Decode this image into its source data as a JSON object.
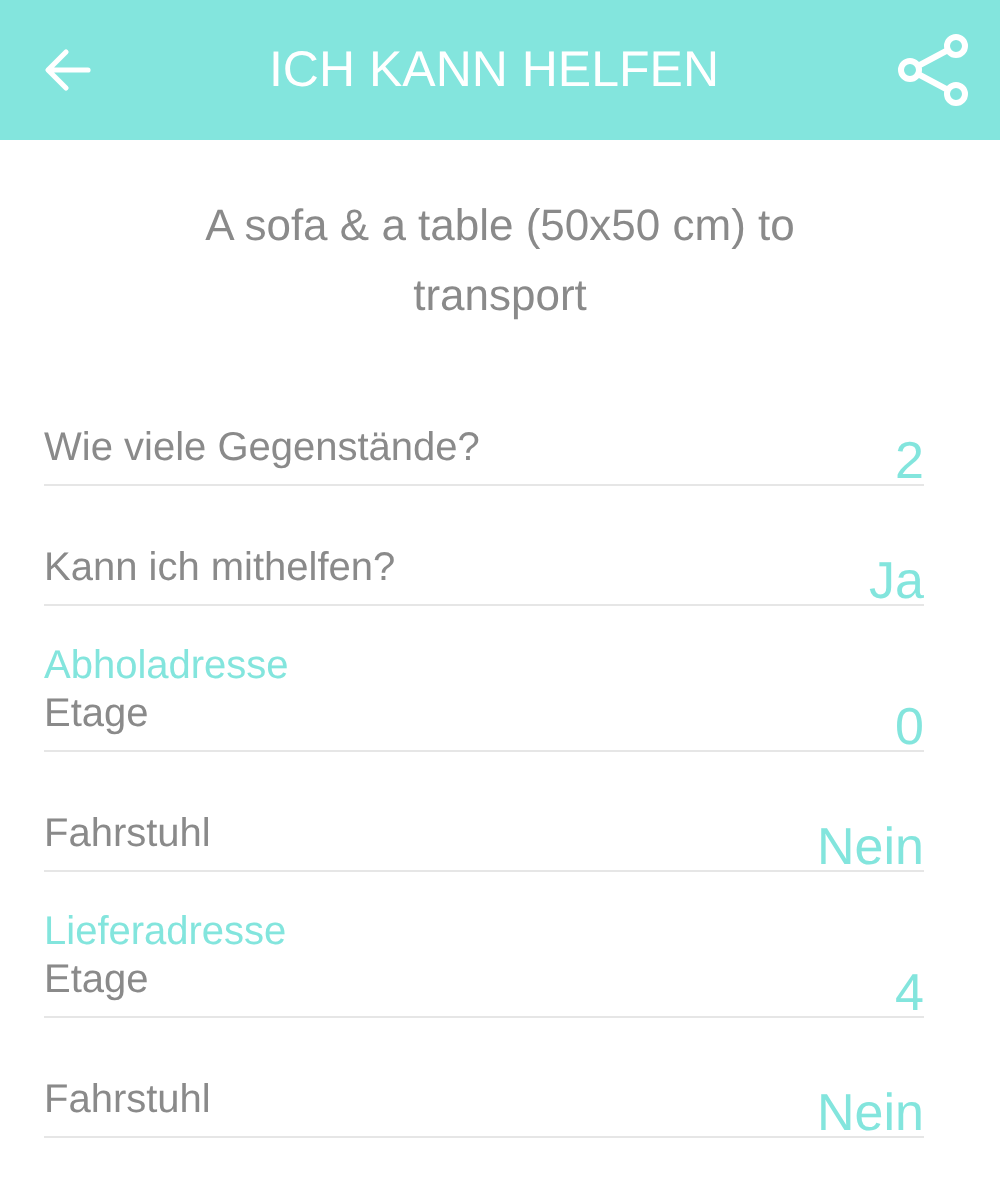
{
  "header": {
    "title": "ICH KANN HELFEN"
  },
  "subtitle": "A sofa & a table (50x50 cm) to transport",
  "items": [
    {
      "kind": "field",
      "label": "Wie viele Gegenstände?",
      "value": "2"
    },
    {
      "kind": "field",
      "label": "Kann ich mithelfen?",
      "value": "Ja"
    },
    {
      "kind": "heading",
      "label": "Abholadresse"
    },
    {
      "kind": "field",
      "label": "Etage",
      "value": "0"
    },
    {
      "kind": "field",
      "label": "Fahrstuhl",
      "value": "Nein"
    },
    {
      "kind": "heading",
      "label": "Lieferadresse"
    },
    {
      "kind": "field",
      "label": "Etage",
      "value": "4"
    },
    {
      "kind": "field",
      "label": "Fahrstuhl",
      "value": "Nein"
    }
  ]
}
